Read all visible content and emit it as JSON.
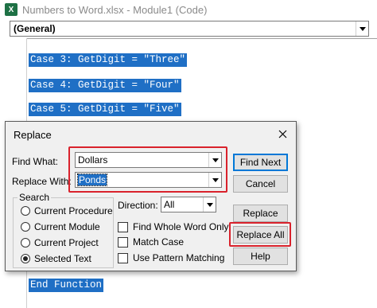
{
  "window": {
    "title": "Numbers to Word.xlsx - Module1 (Code)",
    "app_icon": "excel-icon"
  },
  "code_window": {
    "object_combo": "(General)",
    "lines": [
      "Case 3: GetDigit = \"Three\"",
      "Case 4: GetDigit = \"Four\"",
      "Case 5: GetDigit = \"Five\"",
      "End Function"
    ],
    "selection_color": "#1f6fc5"
  },
  "dialog": {
    "title": "Replace",
    "find_what_label": "Find What:",
    "find_what_value": "Dollars",
    "replace_with_label": "Replace With:",
    "replace_with_value": "Ponds",
    "search_group_label": "Search",
    "search_options": [
      {
        "label": "Current Procedure",
        "selected": false
      },
      {
        "label": "Current Module",
        "selected": false
      },
      {
        "label": "Current Project",
        "selected": false
      },
      {
        "label": "Selected Text",
        "selected": true
      }
    ],
    "direction_label": "Direction:",
    "direction_value": "All",
    "checkboxes": [
      {
        "label": "Find Whole Word Only",
        "checked": false
      },
      {
        "label": "Match Case",
        "checked": false
      },
      {
        "label": "Use Pattern Matching",
        "checked": false
      }
    ],
    "buttons": {
      "find_next": "Find Next",
      "cancel": "Cancel",
      "replace": "Replace",
      "replace_all": "Replace All",
      "help": "Help"
    },
    "highlight_color": "#d9222c"
  }
}
